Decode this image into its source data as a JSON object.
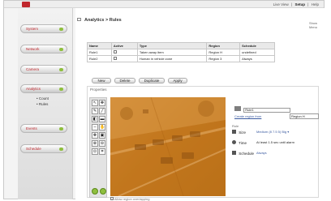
{
  "header": {
    "logo_text": "",
    "links": [
      {
        "label": "Live View"
      },
      {
        "label": "Setup"
      },
      {
        "label": "Help"
      }
    ]
  },
  "sidebar": {
    "items": [
      {
        "label": "System"
      },
      {
        "label": "Network"
      },
      {
        "label": "Camera"
      },
      {
        "label": "Analytics"
      },
      {
        "label": "Events"
      },
      {
        "label": "Schedule"
      }
    ],
    "sub_items": [
      {
        "label": "• Count"
      },
      {
        "label": "• Rules"
      }
    ]
  },
  "breadcrumb": "Analytics > Rules",
  "help": {
    "line1": "Show",
    "line2": "Menu"
  },
  "rules_table": {
    "headers": [
      "Name",
      "Active",
      "Type",
      "Region",
      "Schedule"
    ],
    "rows": [
      {
        "name": "Rule1",
        "type": "Taken away item",
        "region": "Region H",
        "schedule": "undefined"
      },
      {
        "name": "Rule2",
        "type": "Human in vehicle zone",
        "region": "Region 3",
        "schedule": "Always"
      }
    ]
  },
  "actions": {
    "new": "New",
    "delete": "Delete",
    "duplicate": "Duplicate",
    "apply": "Apply"
  },
  "properties": {
    "title": "Properties",
    "overlay_label": "Allow region overlapping"
  },
  "rule_editor": {
    "name_value": "Rule1",
    "region_link": "Create region from",
    "region_select": "Region H",
    "section_title": "Rule",
    "size_label": "Size",
    "size_value": "Medium (8 7.5 5) Big ▾",
    "time_label": "Time",
    "time_value": "At least 1.5 sec until alarm",
    "schedule_label": "Schedule",
    "schedule_value": "Always"
  },
  "colors": {
    "brand": "#c0272d",
    "accent": "#8fbf3f",
    "video_tint": "#c47a20"
  }
}
